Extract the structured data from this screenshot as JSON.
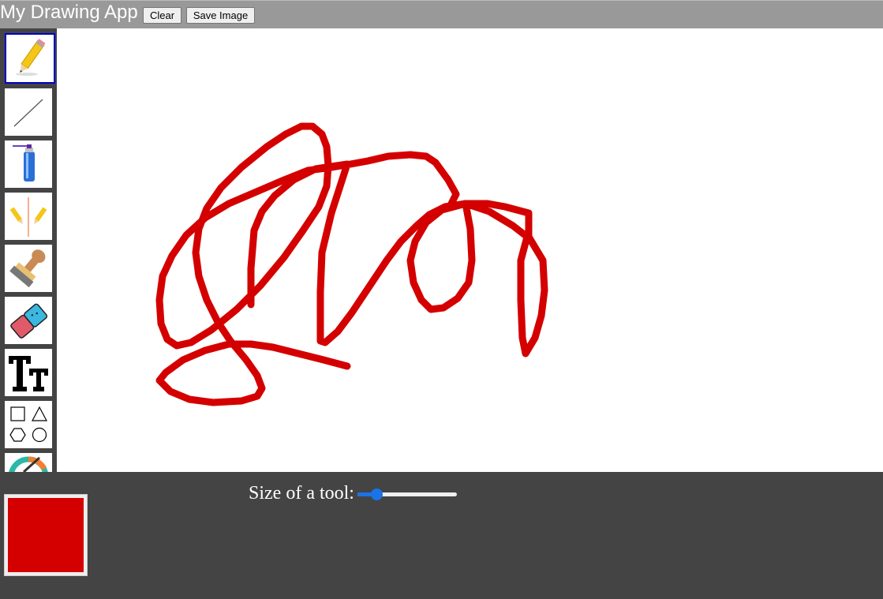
{
  "app": {
    "title": "My Drawing App",
    "clear_label": "Clear",
    "save_label": "Save Image"
  },
  "tools": [
    {
      "name": "pencil",
      "icon": "pencil-icon",
      "selected": true
    },
    {
      "name": "line",
      "icon": "line-icon",
      "selected": false
    },
    {
      "name": "spray",
      "icon": "spray-can-icon",
      "selected": false
    },
    {
      "name": "mirror",
      "icon": "mirror-pencils-icon",
      "selected": false
    },
    {
      "name": "stamp",
      "icon": "stamp-icon",
      "selected": false
    },
    {
      "name": "eraser",
      "icon": "eraser-icon",
      "selected": false
    },
    {
      "name": "text",
      "icon": "text-icon",
      "selected": false
    },
    {
      "name": "shapes",
      "icon": "shapes-icon",
      "selected": false
    },
    {
      "name": "color-picker",
      "icon": "color-wheel-icon",
      "selected": false
    }
  ],
  "bottom": {
    "size_label": "Size of a tool:",
    "size_value_fraction": 0.15,
    "current_color": "#d40000"
  },
  "colors": {
    "stroke": "#d40000",
    "toolbar_bg": "#444444",
    "topbar_bg": "#999999",
    "accent": "#1a73e8"
  }
}
